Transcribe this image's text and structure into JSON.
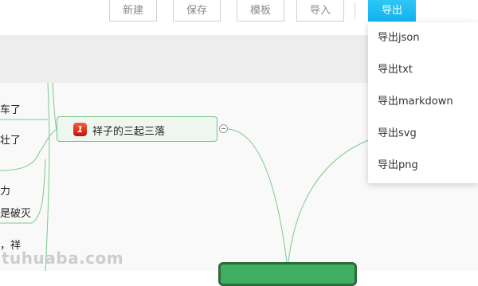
{
  "toolbar": {
    "new_label": "新建",
    "save_label": "保存",
    "template_label": "模板",
    "import_label": "导入",
    "export_label": "导出"
  },
  "export_menu": {
    "items": [
      "导出json",
      "导出txt",
      "导出markdown",
      "导出svg",
      "导出png"
    ]
  },
  "mindmap": {
    "left_leaves": [
      "车了",
      "壮了",
      "力",
      "是破灭",
      "，祥"
    ],
    "main_node": {
      "badge": "1",
      "label": "祥子的三起三落"
    }
  },
  "watermark": "tuhuaba.com",
  "colors": {
    "accent": "#10b2ee",
    "link_line": "#7cc98b",
    "node_border": "#72c283",
    "root_fill": "#3fae60"
  }
}
